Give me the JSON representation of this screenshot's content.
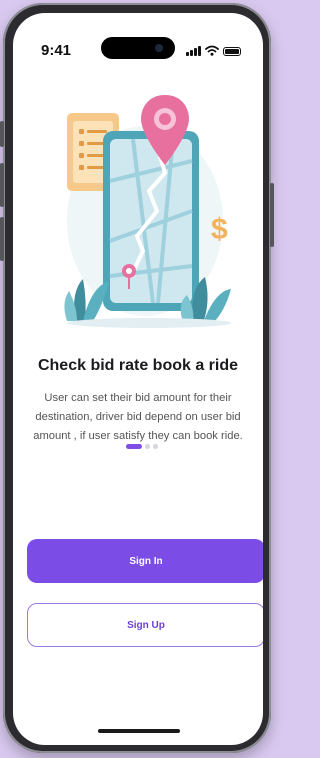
{
  "status_bar": {
    "time": "9:41"
  },
  "onboarding": {
    "title": "Check bid rate book a ride",
    "description": "User can set their bid amount for their destination, driver bid depend on user bid amount , if user satisfy they can book ride.",
    "illustration_currency": "$",
    "page_indicator": {
      "total": 3,
      "current": 1
    }
  },
  "actions": {
    "sign_in_label": "Sign In",
    "sign_up_label": "Sign Up"
  },
  "colors": {
    "accent": "#7b4ce6",
    "pin": "#e8709f",
    "phone_illustration": "#4fa5b8"
  }
}
